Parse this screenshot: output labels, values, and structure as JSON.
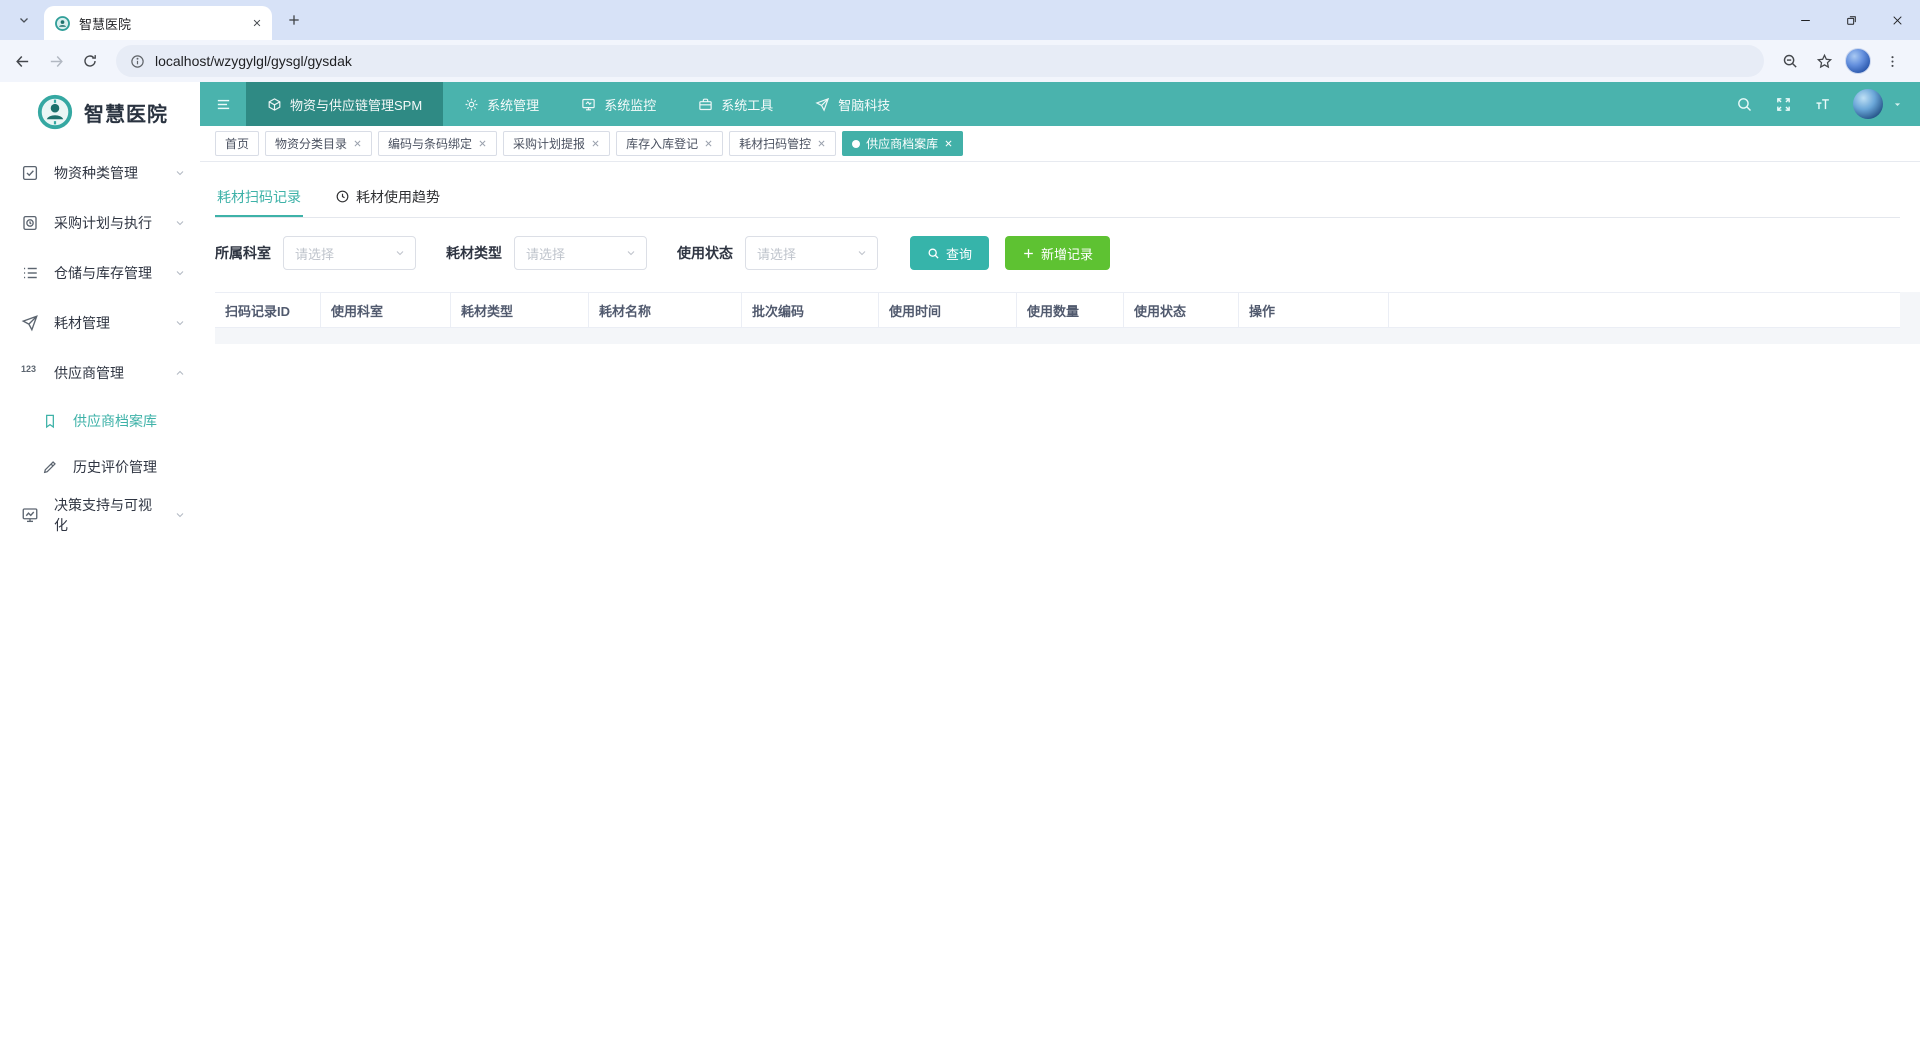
{
  "colors": {
    "accent": "#42b0a8",
    "accent_dark": "#2f8a84",
    "navbar_teal": "#4ab3ad",
    "success_green": "#5ec232",
    "chrome_tabstrip": "#d7e2f7"
  },
  "browser": {
    "tab_title": "智慧医院",
    "url": "localhost/wzygylgl/gysgl/gysdak"
  },
  "topnav": {
    "items": [
      {
        "label": "物资与供应链管理SPM",
        "icon": "cube-icon",
        "active": true
      },
      {
        "label": "系统管理",
        "icon": "gear-icon",
        "active": false
      },
      {
        "label": "系统监控",
        "icon": "monitor-icon",
        "active": false
      },
      {
        "label": "系统工具",
        "icon": "toolbox-icon",
        "active": false
      },
      {
        "label": "智脑科技",
        "icon": "send-icon",
        "active": false
      }
    ]
  },
  "tags": [
    {
      "label": "首页",
      "closable": false,
      "active": false
    },
    {
      "label": "物资分类目录",
      "closable": true,
      "active": false
    },
    {
      "label": "编码与条码绑定",
      "closable": true,
      "active": false
    },
    {
      "label": "采购计划提报",
      "closable": true,
      "active": false
    },
    {
      "label": "库存入库登记",
      "closable": true,
      "active": false
    },
    {
      "label": "耗材扫码管控",
      "closable": true,
      "active": false
    },
    {
      "label": "供应商档案库",
      "closable": true,
      "active": true
    }
  ],
  "sidebar": {
    "brand": "智慧医院",
    "items": [
      {
        "label": "物资种类管理",
        "expanded": false
      },
      {
        "label": "采购计划与执行",
        "expanded": false
      },
      {
        "label": "仓储与库存管理",
        "expanded": false
      },
      {
        "label": "耗材管理",
        "expanded": false
      },
      {
        "label": "供应商管理",
        "expanded": true
      },
      {
        "label": "决策支持与可视化",
        "expanded": false
      }
    ],
    "subitems": [
      {
        "label": "供应商档案库",
        "active": true
      },
      {
        "label": "历史评价管理",
        "active": false
      }
    ]
  },
  "content": {
    "tabs": [
      {
        "label": "耗材扫码记录",
        "active": true
      },
      {
        "label": "耗材使用趋势",
        "active": false
      }
    ],
    "filters": [
      {
        "label": "所属科室",
        "placeholder": "请选择"
      },
      {
        "label": "耗材类型",
        "placeholder": "请选择"
      },
      {
        "label": "使用状态",
        "placeholder": "请选择"
      }
    ],
    "search_button": "查询",
    "add_button": "新增记录",
    "table": {
      "columns": [
        "扫码记录ID",
        "使用科室",
        "耗材类型",
        "耗材名称",
        "批次编码",
        "使用时间",
        "使用数量",
        "使用状态",
        "操作"
      ],
      "rows": []
    }
  }
}
